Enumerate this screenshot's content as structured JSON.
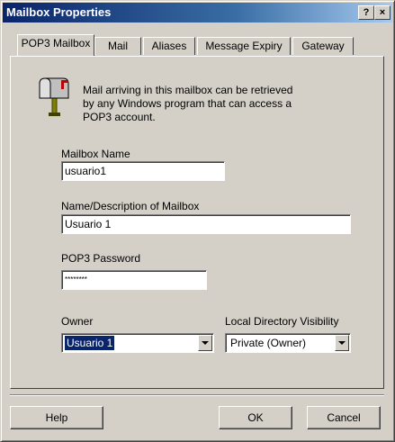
{
  "window": {
    "title": "Mailbox Properties",
    "help_btn": "?",
    "close_btn": "×"
  },
  "tabs": [
    {
      "label": "POP3 Mailbox",
      "active": true
    },
    {
      "label": "Mail"
    },
    {
      "label": "Aliases"
    },
    {
      "label": "Message Expiry"
    },
    {
      "label": "Gateway"
    }
  ],
  "info": {
    "icon": "mailbox-icon",
    "text_line1": "Mail arriving in this mailbox can be retrieved",
    "text_line2": "by any Windows program that can access a",
    "text_line3": "POP3 account."
  },
  "mailbox_name": {
    "label": "Mailbox Name",
    "value": "usuario1"
  },
  "description": {
    "label": "Name/Description of Mailbox",
    "value": "Usuario 1"
  },
  "password": {
    "label": "POP3 Password",
    "value": "********"
  },
  "owner": {
    "label": "Owner",
    "value": "Usuario 1"
  },
  "visibility": {
    "label": "Local Directory Visibility",
    "value": "Private (Owner)"
  },
  "buttons": {
    "help": "Help",
    "ok": "OK",
    "cancel": "Cancel"
  }
}
